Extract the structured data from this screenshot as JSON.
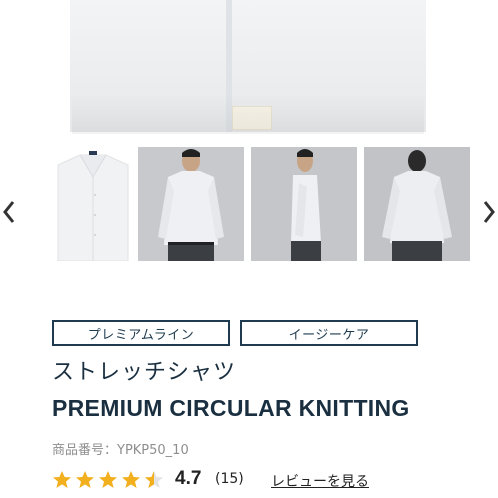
{
  "product": {
    "tags": [
      "プレミアムライン",
      "イージーケア"
    ],
    "title_jp": "ストレッチシャツ",
    "title_en": "PREMIUM CIRCULAR KNITTING",
    "product_number": "商品番号：YPKP50_10",
    "rating": {
      "value": "4.7",
      "count": "(15)",
      "stars": 4.5,
      "review_link": "レビューを見る"
    }
  },
  "gallery": {
    "prev_icon": "chevron-left-icon",
    "next_icon": "chevron-right-icon",
    "thumbnails": [
      "shirt-front",
      "model-front",
      "model-side",
      "model-back"
    ]
  },
  "colors": {
    "tag_border": "#1f3b4f",
    "title": "#1a2f40",
    "star": "#f2b01e"
  }
}
